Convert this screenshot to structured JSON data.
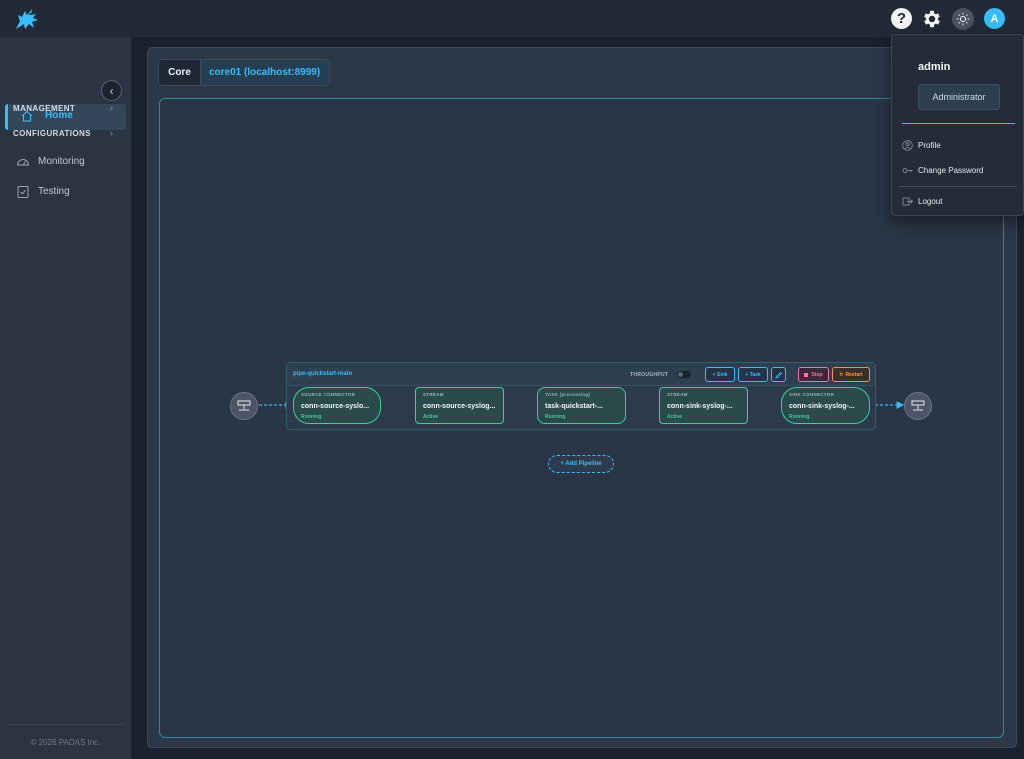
{
  "header": {
    "logo": "padas-dragon-logo",
    "help_icon": "?",
    "user_initial": "A"
  },
  "sidebar": {
    "home_label": "Home",
    "management_label": "MANAGEMENT",
    "configurations_label": "CONFIGURATIONS",
    "monitoring_label": "Monitoring",
    "testing_label": "Testing",
    "copyright": "© 2026 PADAS Inc."
  },
  "core": {
    "label": "Core",
    "value": "core01 (localhost:8999)"
  },
  "pipeline": {
    "name": "pipe-quickstart-main",
    "throughput_label": "THROUGHPUT",
    "add_sink_label": "+ Sink",
    "add_task_label": "+ Task",
    "stop_label": "Stop",
    "restart_label": "Restart",
    "nodes": [
      {
        "type": "SOURCE CONNECTOR",
        "name": "conn-source-syslo...",
        "status": "Running"
      },
      {
        "type": "STREAM",
        "name": "conn-source-syslog...",
        "status": "Active"
      },
      {
        "type": "TASK (processing)",
        "name": "task-quickstart-...",
        "status": "Running"
      },
      {
        "type": "STREAM",
        "name": "conn-sink-syslog-...",
        "status": "Active"
      },
      {
        "type": "SINK CONNECTOR",
        "name": "conn-sink-syslog-...",
        "status": "Running"
      }
    ],
    "add_pipeline_label": "+ Add Pipeline"
  },
  "user_menu": {
    "username": "admin",
    "role": "Administrator",
    "profile_label": "Profile",
    "change_password_label": "Change Password",
    "logout_label": "Logout"
  },
  "colors": {
    "accent": "#38bdf8",
    "status_ok": "#34d399",
    "stop": "#f472b6",
    "restart": "#fb923c"
  }
}
